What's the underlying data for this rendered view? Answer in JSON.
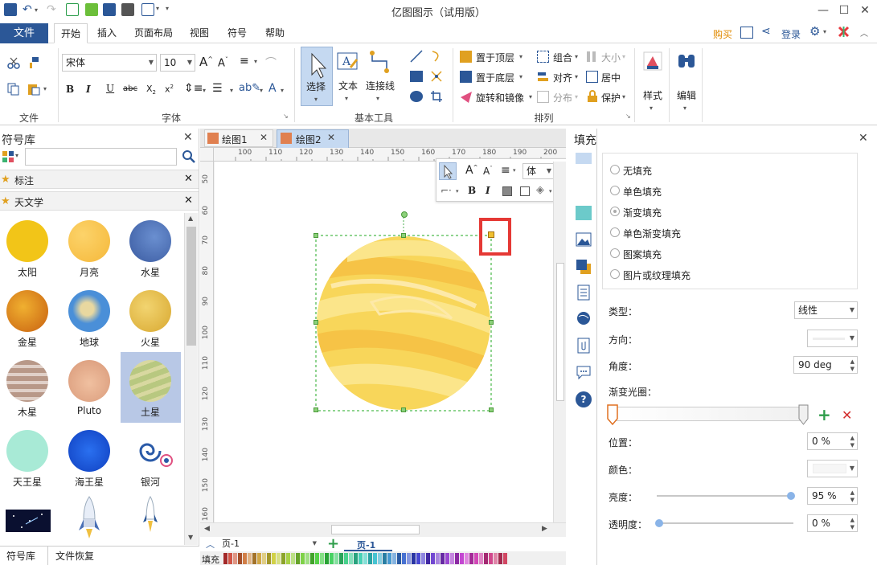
{
  "app": {
    "title": "亿图图示（试用版）"
  },
  "menu": {
    "file": "文件",
    "tabs": [
      "开始",
      "插入",
      "页面布局",
      "视图",
      "符号",
      "帮助"
    ],
    "right": {
      "buy": "购买",
      "login": "登录"
    }
  },
  "ribbon": {
    "file_group": {
      "label": "文件"
    },
    "font": {
      "family": "宋体",
      "size": "10",
      "label": "字体"
    },
    "basic_tools": {
      "select": "选择",
      "text": "文本",
      "connector": "连接线",
      "label": "基本工具"
    },
    "arrange": {
      "bring_front": "置于顶层",
      "send_back": "置于底层",
      "rotate_mirror": "旋转和镜像",
      "group": "组合",
      "align": "对齐",
      "distribute": "分布",
      "size": "大小",
      "center": "居中",
      "protect": "保护",
      "label": "排列"
    },
    "style": "样式",
    "edit": "编辑"
  },
  "symbol_library": {
    "title": "符号库",
    "categories": [
      "标注",
      "天文学"
    ],
    "items": [
      {
        "label": "太阳",
        "color": "#f2c518"
      },
      {
        "label": "月亮",
        "color": "#f7c552"
      },
      {
        "label": "水星",
        "color": "#4a6fb5"
      },
      {
        "label": "金星",
        "color": "#e0a020"
      },
      {
        "label": "地球",
        "color": "#4a8fd8"
      },
      {
        "label": "火星",
        "color": "#e6c04a"
      },
      {
        "label": "木星",
        "color": "#c2a494"
      },
      {
        "label": "Pluto",
        "color": "#e0aa88"
      },
      {
        "label": "土星",
        "color": "#c8d090"
      },
      {
        "label": "天王星",
        "color": "#a8ead6"
      },
      {
        "label": "海王星",
        "color": "#1a5ee0"
      },
      {
        "label": "银河",
        "color": "#2a5aa8"
      }
    ],
    "bottom_tabs": [
      "符号库",
      "文件恢复"
    ]
  },
  "document_tabs": [
    "绘图1",
    "绘图2"
  ],
  "ruler": {
    "h_ticks": [
      "100",
      "110",
      "120",
      "130",
      "140",
      "150",
      "160",
      "170",
      "180",
      "190",
      "200"
    ],
    "v_ticks": [
      "50",
      "60",
      "70",
      "80",
      "90",
      "100",
      "110",
      "120",
      "130",
      "140",
      "150",
      "160"
    ]
  },
  "floating_toolbar": {
    "font_value": "体"
  },
  "page_bar": {
    "page_select": "页-1",
    "page_tab": "页-1",
    "fill_label": "填充"
  },
  "fill_panel": {
    "title": "填充",
    "options": [
      "无填充",
      "单色填充",
      "渐变填充",
      "单色渐变填充",
      "图案填充",
      "图片或纹理填充"
    ],
    "selected": "渐变填充",
    "type_label": "类型：",
    "type_value": "线性",
    "direction_label": "方向：",
    "angle_label": "角度：",
    "angle_value": "90 deg",
    "gradient_stops_label": "渐变光圈：",
    "position_label": "位置：",
    "position_value": "0 %",
    "color_label": "颜色：",
    "brightness_label": "亮度：",
    "brightness_value": "95 %",
    "transparency_label": "透明度：",
    "transparency_value": "0 %"
  },
  "colors": {
    "accent": "#2b5797",
    "highlight": "#e53935",
    "planet_light": "#fbe58a",
    "planet_dark": "#f7c24a"
  }
}
